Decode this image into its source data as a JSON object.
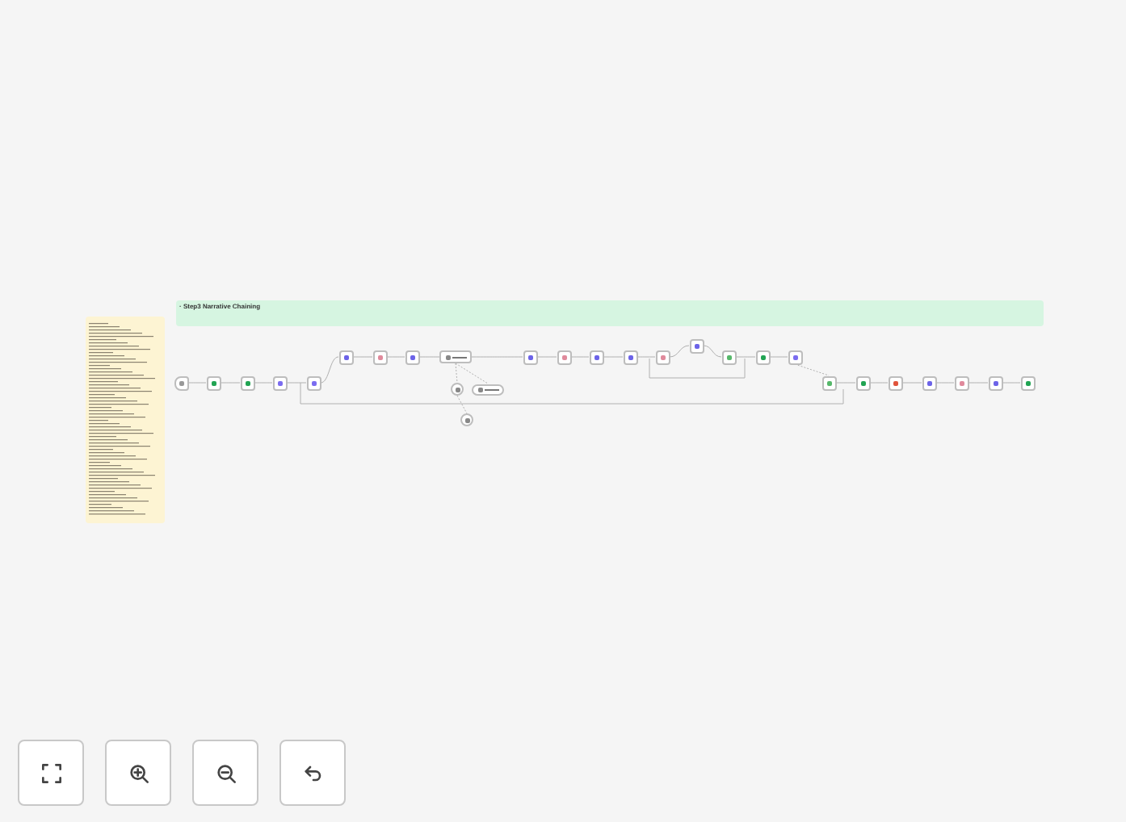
{
  "canvas": {
    "notes": [
      {
        "kind": "section",
        "color": "#d6f5e1",
        "title": "· Step3 Narrative Chaining"
      },
      {
        "kind": "memo",
        "color": "#fdf4d3"
      }
    ],
    "nodes": [
      {
        "kind": "trigger"
      },
      {
        "kind": "sheet"
      },
      {
        "kind": "sheet"
      },
      {
        "kind": "edit"
      },
      {
        "kind": "edit"
      },
      {
        "kind": "ai"
      },
      {
        "kind": "wait"
      },
      {
        "kind": "ai"
      },
      {
        "kind": "wide"
      },
      {
        "kind": "tool"
      },
      {
        "kind": "pill"
      },
      {
        "kind": "tool"
      },
      {
        "kind": "ai"
      },
      {
        "kind": "wait"
      },
      {
        "kind": "ai"
      },
      {
        "kind": "ai"
      },
      {
        "kind": "wait"
      },
      {
        "kind": "ai"
      },
      {
        "kind": "filter"
      },
      {
        "kind": "sheet"
      },
      {
        "kind": "edit"
      },
      {
        "kind": "filter"
      },
      {
        "kind": "sheet"
      },
      {
        "kind": "stop"
      },
      {
        "kind": "ai"
      },
      {
        "kind": "wait"
      },
      {
        "kind": "ai"
      },
      {
        "kind": "sheet"
      }
    ]
  },
  "controls": [
    {
      "kind": "fit"
    },
    {
      "kind": "zoom_in"
    },
    {
      "kind": "zoom_out"
    },
    {
      "kind": "undo"
    }
  ]
}
